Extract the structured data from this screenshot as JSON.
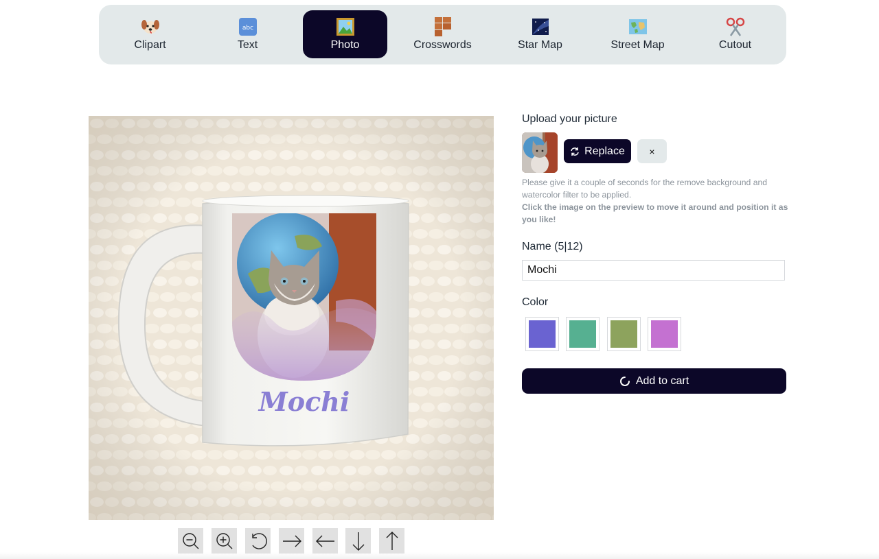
{
  "tabs": [
    {
      "label": "Clipart",
      "icon": "dog-face-icon"
    },
    {
      "label": "Text",
      "icon": "abc-icon"
    },
    {
      "label": "Photo",
      "icon": "framed-picture-icon",
      "active": true
    },
    {
      "label": "Crosswords",
      "icon": "bricks-icon"
    },
    {
      "label": "Star Map",
      "icon": "night-sky-icon"
    },
    {
      "label": "Street Map",
      "icon": "world-map-icon"
    },
    {
      "label": "Cutout",
      "icon": "scissors-icon"
    }
  ],
  "preview": {
    "mug_name": "Mochi",
    "tools": [
      "zoom-out-icon",
      "zoom-in-icon",
      "rotate-icon",
      "arrow-right-icon",
      "arrow-left-icon",
      "arrow-down-icon",
      "arrow-up-icon"
    ]
  },
  "upload": {
    "title": "Upload your picture",
    "replace_label": "Replace",
    "remove_label": "×",
    "note": "Please give it a couple of seconds for the remove background and watercolor filter to be applied.",
    "note_bold": "Click the image on the preview to move it around and position it as you like!"
  },
  "name": {
    "label": "Name (5|12)",
    "value": "Mochi"
  },
  "color": {
    "label": "Color",
    "swatches": [
      "#6a63d1",
      "#56b091",
      "#8da35d",
      "#c471d1"
    ]
  },
  "cart": {
    "label": "Add to cart"
  }
}
